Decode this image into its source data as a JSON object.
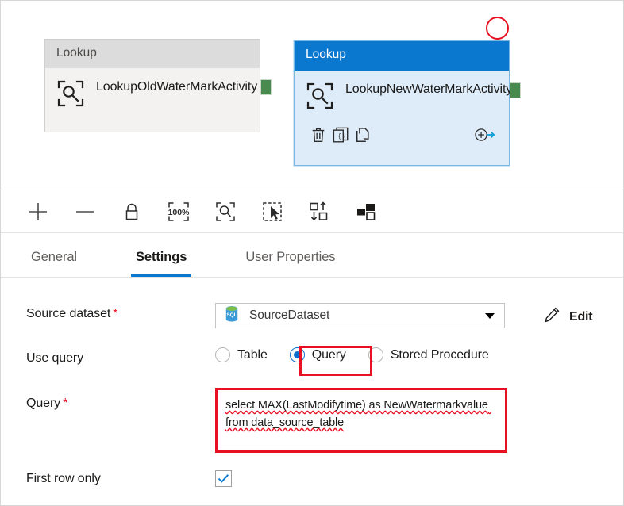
{
  "canvas": {
    "nodes": [
      {
        "header": "Lookup",
        "title": "LookupOldWaterMarkActivity",
        "selected": false,
        "icon": "lookup-icon"
      },
      {
        "header": "Lookup",
        "title": "LookupNewWaterMarkActivity",
        "selected": true,
        "icon": "lookup-icon",
        "actions": [
          {
            "name": "delete-activity",
            "icon": "trash-icon"
          },
          {
            "name": "view-code",
            "icon": "code-brackets-icon"
          },
          {
            "name": "clone-activity",
            "icon": "copy-icon"
          },
          {
            "name": "add-output",
            "icon": "add-output-arrow-icon"
          }
        ]
      }
    ],
    "annotation_circle_color": "#e81123"
  },
  "toolbar": {
    "buttons": [
      {
        "name": "zoom-in",
        "icon": "plus-icon",
        "label": "Zoom in"
      },
      {
        "name": "zoom-out",
        "icon": "minus-icon",
        "label": "Zoom out"
      },
      {
        "name": "lock-canvas",
        "icon": "lock-icon",
        "label": "Lock"
      },
      {
        "name": "zoom-to-100",
        "icon": "zoom-100-percent-icon",
        "label": "100%"
      },
      {
        "name": "zoom-to-fit",
        "icon": "zoom-fit-icon",
        "label": "Zoom to fit"
      },
      {
        "name": "select-tool",
        "icon": "select-cursor-icon",
        "label": "Select"
      },
      {
        "name": "auto-align",
        "icon": "auto-align-icon",
        "label": "Auto align"
      },
      {
        "name": "layout-view",
        "icon": "layout-blocks-icon",
        "label": "Layout"
      }
    ],
    "zoom_level": "100%"
  },
  "tabs": [
    {
      "label": "General",
      "active": false
    },
    {
      "label": "Settings",
      "active": true
    },
    {
      "label": "User Properties",
      "active": false
    }
  ],
  "settings": {
    "source_dataset": {
      "label": "Source dataset",
      "required_marker": "*",
      "value": "SourceDataset",
      "dataset_icon": "sql-database-icon",
      "dataset_icon_text": "SQL",
      "edit_label": "Edit",
      "edit_icon": "pencil-icon"
    },
    "use_query": {
      "label": "Use query",
      "options": [
        {
          "label": "Table",
          "checked": false
        },
        {
          "label": "Query",
          "checked": true
        },
        {
          "label": "Stored Procedure",
          "checked": false
        }
      ]
    },
    "query": {
      "label": "Query",
      "required_marker": "*",
      "value": "select MAX(LastModifytime) as NewWatermarkvalue from data_source_table"
    },
    "first_row_only": {
      "label": "First row only",
      "checked": true,
      "check_color": "#0b78d0"
    }
  }
}
